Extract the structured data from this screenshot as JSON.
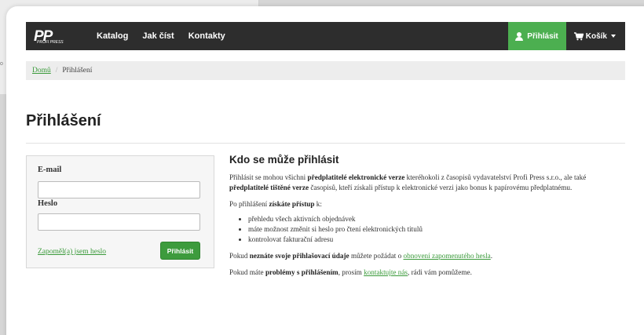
{
  "background": {
    "fragment_text": "o"
  },
  "nav": {
    "logo_mark": "PP",
    "logo_sub": "PROFI PRESS",
    "links": [
      "Katalog",
      "Jak číst",
      "Kontakty"
    ],
    "login_label": "Přihlásit",
    "cart_label": "Košík"
  },
  "breadcrumb": {
    "home": "Domů",
    "separator": "/",
    "current": "Přihlášení"
  },
  "page_title": "Přihlášení",
  "form": {
    "email_label": "E-mail",
    "email_value": "",
    "password_label": "Heslo",
    "password_value": "",
    "forgot_link": "Zapoměl(a) jsem heslo",
    "submit_label": "Přihlásit"
  },
  "info": {
    "heading": "Kdo se může přihlásit",
    "p1_a": "Přihlásit se mohou všichni ",
    "p1_b": "předplatitelé elektronické verze",
    "p1_c": " kteréhokoli z časopisů vydavatelství Profi Press s.r.o., ale také ",
    "p1_d": "předplatitelé tištěné verze",
    "p1_e": " časopisů, kteří získali přístup k elektronické verzi jako bonus k papírovému předplatnému.",
    "p2_a": "Po přihlášení ",
    "p2_b": "získáte přístup",
    "p2_c": " k:",
    "bullets": [
      "přehledu všech aktivních objednávek",
      "máte možnost změnit si heslo pro čtení elektronických titulů",
      "kontrolovat fakturační adresu"
    ],
    "p3_a": "Pokud ",
    "p3_b": "neznáte svoje přihlašovací údaje",
    "p3_c": " můžete požádat o ",
    "p3_link": "obnovení zapomenutého hesla",
    "p3_d": ".",
    "p4_a": "Pokud máte ",
    "p4_b": "problémy s přihlášením",
    "p4_c": ", prosím ",
    "p4_link": "kontaktujte nás",
    "p4_d": ", rádi vám pomůžeme."
  },
  "colors": {
    "accent_green": "#4caf50",
    "nav_dark": "#2d2d2d",
    "link_green": "#3a9a3a"
  }
}
